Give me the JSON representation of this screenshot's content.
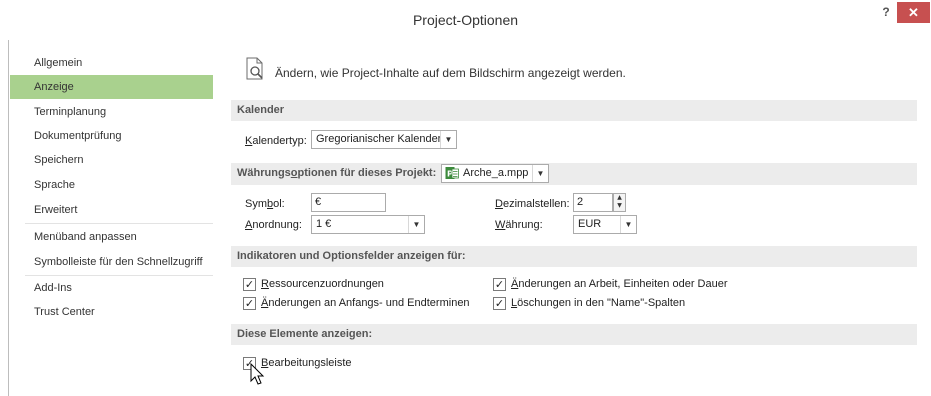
{
  "window": {
    "title": "Project-Optionen",
    "help_label": "?",
    "close_label": "✕"
  },
  "sidebar": {
    "items": [
      {
        "label": "Allgemein"
      },
      {
        "label": "Anzeige"
      },
      {
        "label": "Terminplanung"
      },
      {
        "label": "Dokumentprüfung"
      },
      {
        "label": "Speichern"
      },
      {
        "label": "Sprache"
      },
      {
        "label": "Erweitert"
      },
      {
        "label": "Menüband anpassen"
      },
      {
        "label": "Symbolleiste für den Schnellzugriff"
      },
      {
        "label": "Add-Ins"
      },
      {
        "label": "Trust Center"
      }
    ]
  },
  "header": {
    "text": "Ändern, wie Project-Inhalte auf dem Bildschirm angezeigt werden."
  },
  "calendar": {
    "section_title": "Kalender",
    "type_label_u": "K",
    "type_label_rest": "alendertyp:",
    "type_value": "Gregorianischer Kalender"
  },
  "currency": {
    "section_prefix": "Währungs",
    "section_u": "o",
    "section_rest": "ptionen für dieses Projekt:",
    "project_value": "Arche_a.mpp",
    "symbol_label_pre": "Sym",
    "symbol_label_u": "b",
    "symbol_label_rest": "ol:",
    "symbol_value": "€",
    "placement_label_u": "A",
    "placement_label_rest": "nordnung:",
    "placement_value": "1 €",
    "decimals_label_u": "D",
    "decimals_label_rest": "ezimalstellen:",
    "decimals_value": "2",
    "currency_label_u": "W",
    "currency_label_rest": "ährung:",
    "currency_value": "EUR"
  },
  "indicators": {
    "section_title": "Indikatoren und Optionsfelder anzeigen für:",
    "items": [
      {
        "u": "R",
        "rest": "essourcenzuordnungen",
        "checked": true
      },
      {
        "u": "Ä",
        "rest": "nderungen an Anfangs- und Endterminen",
        "checked": true
      },
      {
        "u": "Ä",
        "rest": "nderungen an Arbeit, Einheiten oder Dauer",
        "checked": true
      },
      {
        "u": "L",
        "rest": "öschungen in den \"Name\"-Spalten",
        "checked": true
      }
    ]
  },
  "elements": {
    "section_title": "Diese Elemente anzeigen:",
    "items": [
      {
        "u": "B",
        "rest": "earbeitungsleiste",
        "checked": true
      }
    ]
  },
  "glyphs": {
    "check": "✓",
    "dropdown": "▼",
    "spin_up": "▲",
    "spin_down": "▼"
  },
  "colors": {
    "active_nav": "#a9d18e",
    "close_button": "#c75050",
    "section_bg": "#ececec"
  }
}
